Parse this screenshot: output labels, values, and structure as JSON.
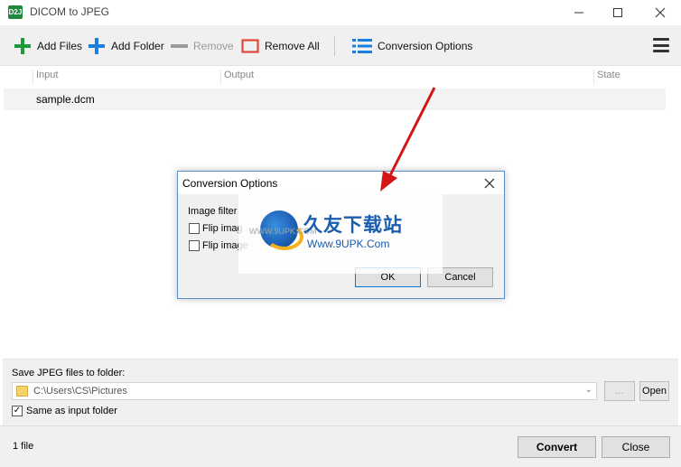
{
  "window": {
    "title": "DICOM to JPEG",
    "app_icon_text": "D2J"
  },
  "toolbar": {
    "add_files": "Add Files",
    "add_folder": "Add Folder",
    "remove": "Remove",
    "remove_all": "Remove All",
    "conversion_options": "Conversion Options"
  },
  "filelist": {
    "columns": [
      "Input",
      "Output",
      "State"
    ],
    "rows": [
      {
        "input": "sample.dcm",
        "output": "",
        "state": ""
      }
    ]
  },
  "output": {
    "label": "Save JPEG files to folder:",
    "path": "C:\\Users\\CS\\Pictures",
    "browse_label": "...",
    "open_label": "Open",
    "same_as_input_label": "Same as input folder",
    "same_as_input_checked": true
  },
  "status": {
    "text": "1 file",
    "convert_label": "Convert",
    "close_label": "Close"
  },
  "dialog": {
    "title": "Conversion Options",
    "group_label": "Image filter",
    "option1": "Flip imag",
    "option2": "Flip image",
    "ok_label": "OK",
    "cancel_label": "Cancel"
  },
  "watermark": {
    "cn": "久友下载站",
    "url": "Www.9UPK.Com",
    "small": "WWW.9UPK.COM"
  },
  "colors": {
    "accent": "#0078d7",
    "add_green": "#1c9b3a",
    "add_blue": "#1c7fe0",
    "remove_all_red": "#e0483a",
    "arrow_red": "#d51515"
  }
}
